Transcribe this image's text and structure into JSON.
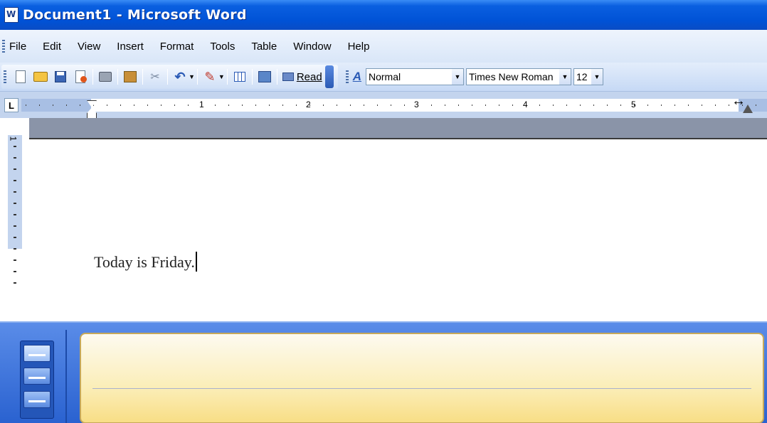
{
  "window": {
    "title": "Document1 - Microsoft Word"
  },
  "menu": [
    "File",
    "Edit",
    "View",
    "Insert",
    "Format",
    "Tools",
    "Table",
    "Window",
    "Help"
  ],
  "toolbar": {
    "read_label": "Read",
    "style_value": "Normal",
    "font_value": "Times New Roman",
    "size_value": "12"
  },
  "ruler": {
    "tab_selector": "L",
    "numbers": [
      "1",
      "2",
      "3",
      "4",
      "5"
    ]
  },
  "vertical_ruler": {
    "number": "1"
  },
  "document": {
    "text": "Today is Friday."
  },
  "icons": {
    "new": "new-document-icon",
    "open": "open-folder-icon",
    "save": "save-icon",
    "permission": "permission-icon",
    "print": "print-icon",
    "research": "research-icon",
    "cut": "cut-icon",
    "undo": "undo-icon",
    "format_painter": "format-painter-icon",
    "table": "insert-table-icon",
    "document_map": "document-map-icon",
    "styles": "styles-formatting-icon"
  }
}
